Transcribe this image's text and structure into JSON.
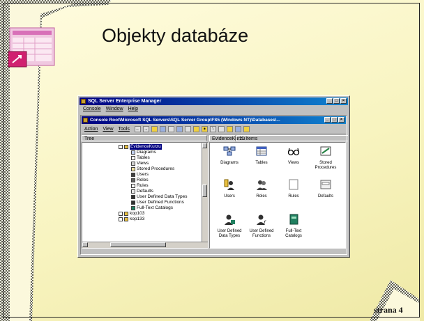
{
  "slide": {
    "title": "Objekty databáze",
    "page_number": "strana 4"
  },
  "app": {
    "title": "SQL Server Enterprise Manager",
    "menu": [
      "Console",
      "Window",
      "Help"
    ],
    "console_title": "Console Root\\Microsoft SQL Servers\\SQL Server Group\\FS5 (Windows NT)\\Databases\\...",
    "toolbar_menus": [
      "Action",
      "View",
      "Tools"
    ],
    "tree_tab": "Tree",
    "list_header_name": "EvidenceKurzu",
    "list_header_count": "11 Items",
    "tree": {
      "root": "EvidenceKurzu",
      "children": [
        "Diagrams",
        "Tables",
        "Views",
        "Stored Procedures",
        "Users",
        "Roles",
        "Rules",
        "Defaults",
        "User Defined Data Types",
        "User Defined Functions",
        "Full-Text Catalogs"
      ],
      "siblings": [
        "kop103",
        "kop133"
      ]
    },
    "items": [
      {
        "label": "Diagrams",
        "icon": "diagram-icon"
      },
      {
        "label": "Tables",
        "icon": "table-icon"
      },
      {
        "label": "Views",
        "icon": "glasses-icon"
      },
      {
        "label": "Stored Procedures",
        "icon": "procedure-icon"
      },
      {
        "label": "Users",
        "icon": "user-icon"
      },
      {
        "label": "Roles",
        "icon": "roles-icon"
      },
      {
        "label": "Rules",
        "icon": "rules-icon"
      },
      {
        "label": "Defaults",
        "icon": "defaults-icon"
      },
      {
        "label": "User Defined Data Types",
        "icon": "udt-icon"
      },
      {
        "label": "User Defined Functions",
        "icon": "udf-icon"
      },
      {
        "label": "Full-Text Catalogs",
        "icon": "catalog-icon"
      }
    ]
  }
}
